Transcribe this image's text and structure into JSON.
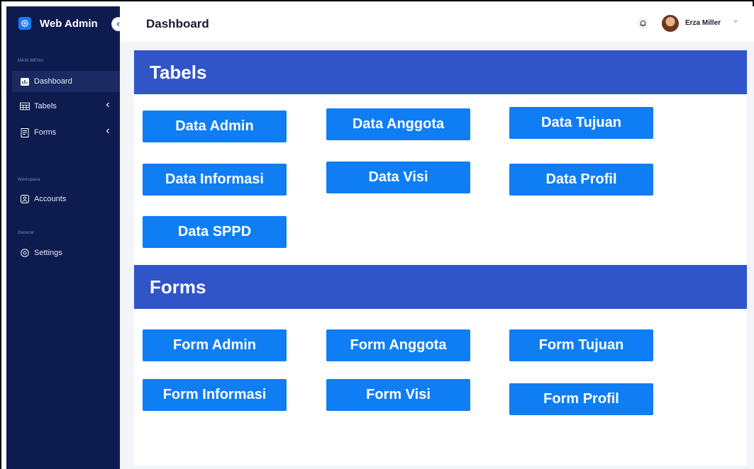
{
  "brand": {
    "title": "Web Admin"
  },
  "sidebar": {
    "main_menu_label": "MAIN MENU",
    "items": [
      {
        "label": "Dashboard"
      },
      {
        "label": "Tabels"
      },
      {
        "label": "Forms"
      }
    ],
    "workspace_label": "Workspace",
    "workspace_items": [
      {
        "label": "Accounts"
      }
    ],
    "general_label": "General",
    "general_items": [
      {
        "label": "Settings"
      }
    ]
  },
  "header": {
    "title": "Dashboard",
    "user_name": "Erza Miller"
  },
  "tabels": {
    "title": "Tabels",
    "buttons": [
      "Data Admin",
      "Data Anggota",
      "Data Tujuan",
      "Data Informasi",
      "Data Visi",
      "Data Profil",
      "Data SPPD"
    ]
  },
  "forms": {
    "title": "Forms",
    "buttons": [
      "Form Admin",
      "Form Anggota",
      "Form Tujuan",
      "Form Informasi",
      "Form Visi",
      "Form Profil"
    ]
  },
  "colors": {
    "sidebar": "#0d1b4f",
    "section_bar": "#2f55c9",
    "button": "#0f7ef5"
  }
}
